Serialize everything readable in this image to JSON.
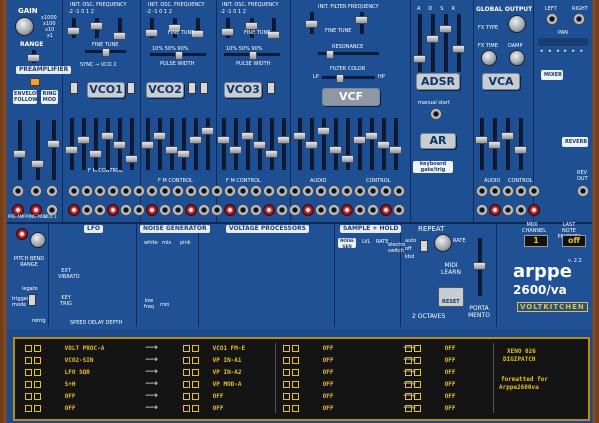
{
  "left_section": {
    "gain_label": "GAIN",
    "gain_opts": [
      "x1000",
      "x100",
      "x10",
      "x1"
    ],
    "range_label": "RANGE",
    "preamp_label": "PREAMPLIFIER",
    "env_follower_label": "ENVELOPE FOLLOWER",
    "ring_mod_label": "RING MOD",
    "pre_amp_jack": "PRE AMP",
    "ring_mod_jack": "RING MOD",
    "vco_label_small": "VCO 1"
  },
  "vcos": [
    {
      "name": "VCO1",
      "header": "INIT. OSC. FREQUENCY",
      "fine": "FINE TUNE",
      "pulse": "PULSE WIDTH",
      "sync": "SYNC → VCO 2",
      "cv": "10%   50%   90%"
    },
    {
      "name": "VCO2",
      "header": "INIT. OSC. FREQUENCY",
      "fine": "FINE TUNE",
      "pulse": "PULSE WIDTH",
      "sync": "",
      "cv": "10%   50%   90%"
    },
    {
      "name": "VCO3",
      "header": "INIT. OSC. FREQUENCY",
      "fine": "FINE TUNE",
      "pulse": "PULSE WIDTH",
      "sync": "",
      "cv": "10%   50%   90%"
    }
  ],
  "vcf": {
    "name": "VCF",
    "header": "INIT. FILTER FREQUENCY",
    "fine": "FINE TUNE",
    "resonance": "RESONANCE",
    "filter_color": "FILTER COLOR",
    "lp": "LP",
    "hp": "HP"
  },
  "adsr": {
    "name": "ADSR",
    "stages": [
      "A",
      "D",
      "S",
      "R"
    ]
  },
  "ar": {
    "name": "AR",
    "manual": "manual start",
    "keyboard": "keyboard gate/trig"
  },
  "vca": {
    "name": "VCA",
    "global": "GLOBAL OUTPUT",
    "fx_type": "FX TYPE",
    "fx_time": "FX TIME",
    "damp": "DAMP"
  },
  "right_col": {
    "left": "LEFT",
    "right": "RIGHT",
    "pan": "PAN",
    "mixer": "MIXER",
    "reverb": "REVERB",
    "rev_out": "REV OUT"
  },
  "control_labels": {
    "fm_control": "F M CONTROL",
    "audio": "AUDIO",
    "control": "CONTROL"
  },
  "bottom": {
    "pitch_bend": "PITCH BEND RANGE",
    "lfo": "LFO",
    "trigger_mode": "trigger mode",
    "legato": "legato",
    "retrig": "retrig",
    "ext_vibrato": "EXT VIBRATO",
    "key_trig": "KEY TRIG",
    "speed_delay_depth": "SPEED DELAY DEPTH",
    "noise_gen": "NOISE GENERATOR",
    "noise_white": "white",
    "noise_pink": "pink",
    "noise_mix": "mix",
    "low_freq": "low freq",
    "noise_min": "min",
    "voltage_proc": "VOLTAGE PROCESSORS",
    "sample_hold": "SAMPLE + HOLD",
    "noise_gen_btn": "NOISE GEN",
    "lvl_label": "LVL",
    "rate_label": "RATE",
    "electric_switch": "electro switch",
    "repeat": "REPEAT",
    "auto": "auto",
    "off": "off",
    "kbd": "kbd",
    "rate": "RATE",
    "midi_learn": "MIDI LEARN",
    "reset": "RESET",
    "two_octaves": "2 OCTAVES",
    "porta_mento": "PORTA MENTO",
    "midi_channel": "MIDI CHANNEL",
    "channel_value": "1",
    "last_note_priority": "LAST NOTE PRIORITY",
    "priority_value": "off",
    "brand": "arppe",
    "model": "2600/va",
    "version": "v. 2.2",
    "maker": "VOLTKITCHEN"
  },
  "patchbay": {
    "col1": [
      "VOLT PROC-A",
      "VCO2-SIN",
      "LFO SQR",
      "S+H",
      "OFF",
      "OFF"
    ],
    "col2": [
      "VCO1 FM-E",
      "VP IN-A1",
      "VP IN-A2",
      "VP MOD-A",
      "OFF",
      "OFF"
    ],
    "col3": [
      "OFF",
      "OFF",
      "OFF",
      "OFF",
      "OFF",
      "OFF"
    ],
    "col4": [
      "OFF",
      "OFF",
      "OFF",
      "OFF",
      "OFF",
      "OFF"
    ],
    "title1": "XENO 026",
    "title2": "DIGIPATCH",
    "formatted": "formatted for",
    "formatted2": "Arppe2600va"
  },
  "colors": {
    "panel": "#1e4f92",
    "wood": "#7a3d1c",
    "amber": "#e6c024"
  }
}
